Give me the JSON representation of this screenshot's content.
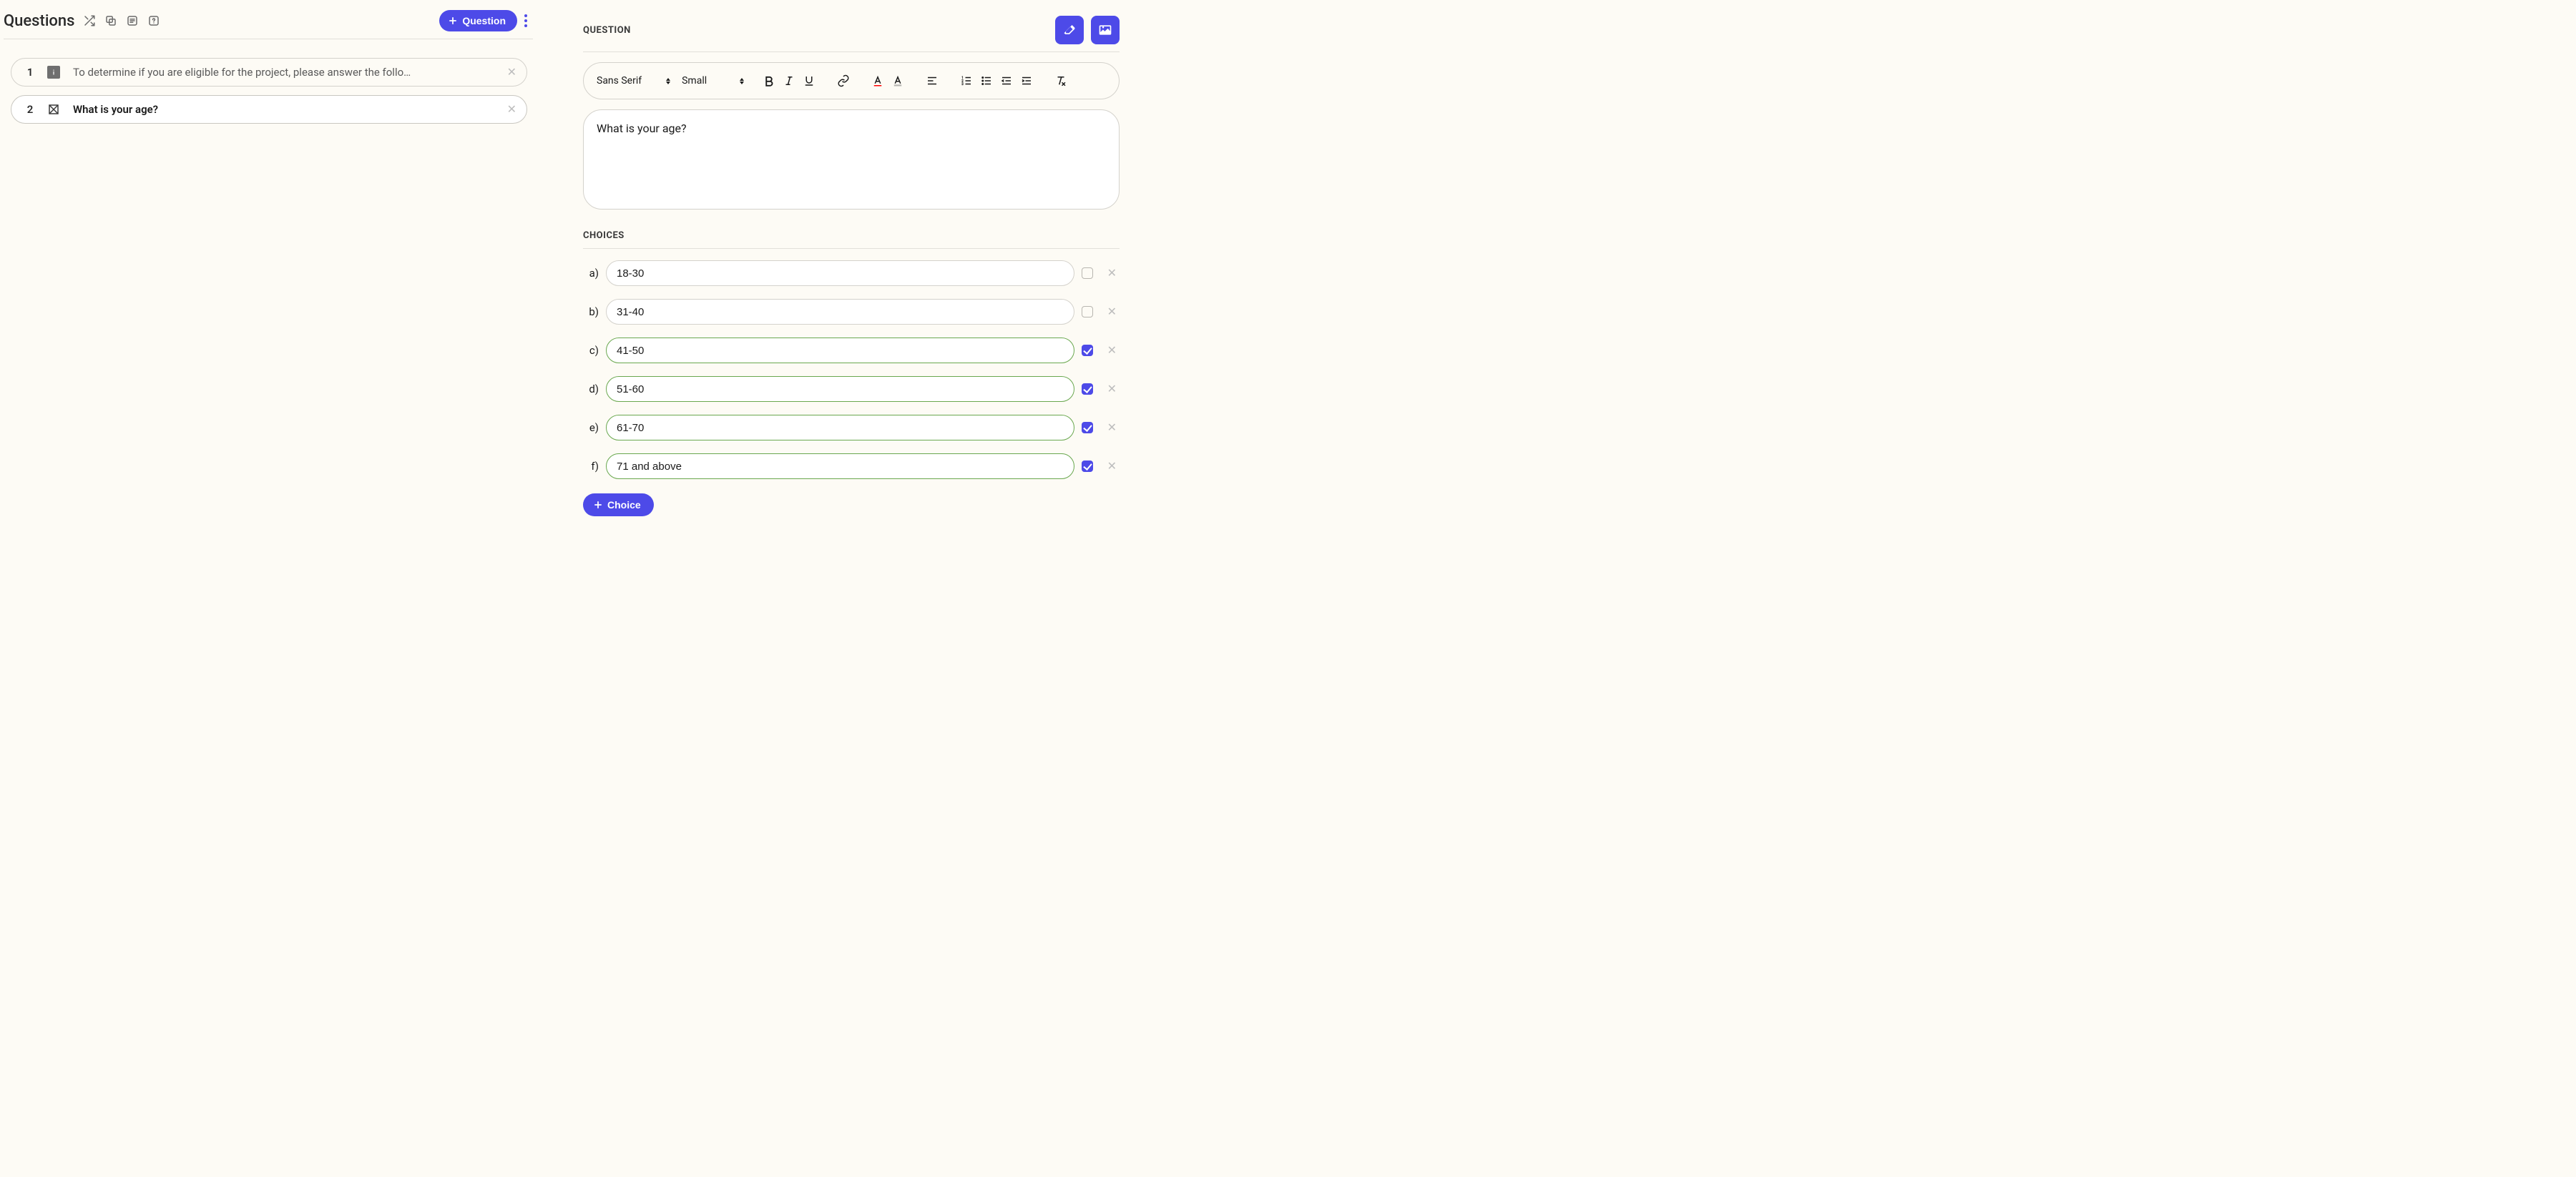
{
  "left": {
    "title": "Questions",
    "add_button": "Question",
    "items": [
      {
        "num": "1",
        "type": "info",
        "text": "To determine if you are eligible for the project, please answer the follo…",
        "active": false
      },
      {
        "num": "2",
        "type": "multi",
        "text": "What is your age?",
        "active": true
      }
    ]
  },
  "right": {
    "question_label": "QUESTION",
    "choices_label": "CHOICES",
    "font_family": "Sans Serif",
    "font_size": "Small",
    "question_text": "What is your age?",
    "choices": [
      {
        "label": "a)",
        "value": "18-30",
        "correct": false
      },
      {
        "label": "b)",
        "value": "31-40",
        "correct": false
      },
      {
        "label": "c)",
        "value": "41-50",
        "correct": true
      },
      {
        "label": "d)",
        "value": "51-60",
        "correct": true
      },
      {
        "label": "e)",
        "value": "61-70",
        "correct": true
      },
      {
        "label": "f)",
        "value": "71 and above",
        "correct": true
      }
    ],
    "add_choice": "Choice"
  }
}
